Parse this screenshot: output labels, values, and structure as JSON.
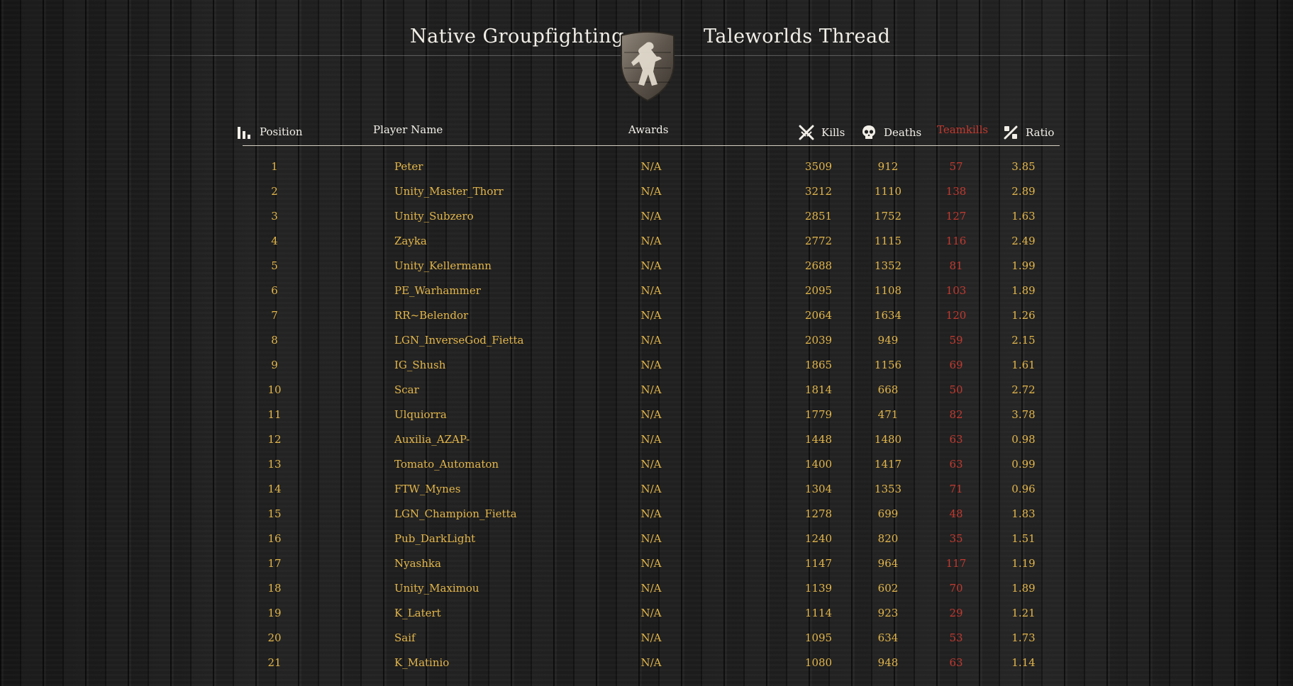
{
  "nav": {
    "left_link": "Native Groupfighting",
    "right_link": "Taleworlds Thread"
  },
  "table": {
    "headers": {
      "position": "Position",
      "player_name": "Player Name",
      "awards": "Awards",
      "kills": "Kills",
      "deaths": "Deaths",
      "teamkills": "Teamkills",
      "ratio": "Ratio"
    },
    "rows": [
      {
        "pos": "1",
        "name": "Peter",
        "awards": "N/A",
        "kills": "3509",
        "deaths": "912",
        "tk": "57",
        "ratio": "3.85"
      },
      {
        "pos": "2",
        "name": "Unity_Master_Thorr",
        "awards": "N/A",
        "kills": "3212",
        "deaths": "1110",
        "tk": "138",
        "ratio": "2.89"
      },
      {
        "pos": "3",
        "name": "Unity_Subzero",
        "awards": "N/A",
        "kills": "2851",
        "deaths": "1752",
        "tk": "127",
        "ratio": "1.63"
      },
      {
        "pos": "4",
        "name": "Zayka",
        "awards": "N/A",
        "kills": "2772",
        "deaths": "1115",
        "tk": "116",
        "ratio": "2.49"
      },
      {
        "pos": "5",
        "name": "Unity_Kellermann",
        "awards": "N/A",
        "kills": "2688",
        "deaths": "1352",
        "tk": "81",
        "ratio": "1.99"
      },
      {
        "pos": "6",
        "name": "PE_Warhammer",
        "awards": "N/A",
        "kills": "2095",
        "deaths": "1108",
        "tk": "103",
        "ratio": "1.89"
      },
      {
        "pos": "7",
        "name": "RR~Belendor",
        "awards": "N/A",
        "kills": "2064",
        "deaths": "1634",
        "tk": "120",
        "ratio": "1.26"
      },
      {
        "pos": "8",
        "name": "LGN_InverseGod_Fietta",
        "awards": "N/A",
        "kills": "2039",
        "deaths": "949",
        "tk": "59",
        "ratio": "2.15"
      },
      {
        "pos": "9",
        "name": "IG_Shush",
        "awards": "N/A",
        "kills": "1865",
        "deaths": "1156",
        "tk": "69",
        "ratio": "1.61"
      },
      {
        "pos": "10",
        "name": "Scar",
        "awards": "N/A",
        "kills": "1814",
        "deaths": "668",
        "tk": "50",
        "ratio": "2.72"
      },
      {
        "pos": "11",
        "name": "Ulquiorra",
        "awards": "N/A",
        "kills": "1779",
        "deaths": "471",
        "tk": "82",
        "ratio": "3.78"
      },
      {
        "pos": "12",
        "name": "Auxilia_AZAP-",
        "awards": "N/A",
        "kills": "1448",
        "deaths": "1480",
        "tk": "63",
        "ratio": "0.98"
      },
      {
        "pos": "13",
        "name": "Tomato_Automaton",
        "awards": "N/A",
        "kills": "1400",
        "deaths": "1417",
        "tk": "63",
        "ratio": "0.99"
      },
      {
        "pos": "14",
        "name": "FTW_Mynes",
        "awards": "N/A",
        "kills": "1304",
        "deaths": "1353",
        "tk": "71",
        "ratio": "0.96"
      },
      {
        "pos": "15",
        "name": "LGN_Champion_Fietta",
        "awards": "N/A",
        "kills": "1278",
        "deaths": "699",
        "tk": "48",
        "ratio": "1.83"
      },
      {
        "pos": "16",
        "name": "Pub_DarkLight",
        "awards": "N/A",
        "kills": "1240",
        "deaths": "820",
        "tk": "35",
        "ratio": "1.51"
      },
      {
        "pos": "17",
        "name": "Nyashka",
        "awards": "N/A",
        "kills": "1147",
        "deaths": "964",
        "tk": "117",
        "ratio": "1.19"
      },
      {
        "pos": "18",
        "name": "Unity_Maximou",
        "awards": "N/A",
        "kills": "1139",
        "deaths": "602",
        "tk": "70",
        "ratio": "1.89"
      },
      {
        "pos": "19",
        "name": "K_Latert",
        "awards": "N/A",
        "kills": "1114",
        "deaths": "923",
        "tk": "29",
        "ratio": "1.21"
      },
      {
        "pos": "20",
        "name": "Saif",
        "awards": "N/A",
        "kills": "1095",
        "deaths": "634",
        "tk": "53",
        "ratio": "1.73"
      },
      {
        "pos": "21",
        "name": "K_Matinio",
        "awards": "N/A",
        "kills": "1080",
        "deaths": "948",
        "tk": "63",
        "ratio": "1.14"
      }
    ]
  },
  "colors": {
    "row_text": "#e3b64a",
    "teamkills": "#c2392f",
    "header_text": "#f2efe8"
  }
}
